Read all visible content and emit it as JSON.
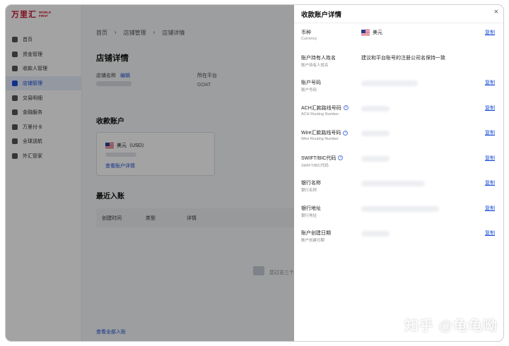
{
  "logo": {
    "cn": "万里汇",
    "en": "WORLD FIRST"
  },
  "sidebar": {
    "items": [
      {
        "label": "首页",
        "icon": "home-icon"
      },
      {
        "label": "资金管理",
        "icon": "funds-icon"
      },
      {
        "label": "收款人管理",
        "icon": "payee-icon"
      },
      {
        "label": "店铺管理",
        "icon": "store-icon",
        "active": true
      },
      {
        "label": "交易明细",
        "icon": "transactions-icon"
      },
      {
        "label": "金融服务",
        "icon": "finance-icon"
      },
      {
        "label": "万里付卡",
        "icon": "card-icon"
      },
      {
        "label": "全球送航",
        "icon": "global-icon"
      },
      {
        "label": "外汇管家",
        "icon": "fx-icon"
      }
    ]
  },
  "main": {
    "breadcrumb": [
      "首页",
      "›",
      "店铺管理",
      "›",
      "店铺详情"
    ],
    "title": "店铺详情",
    "store_name_label": "店铺名称",
    "edit_label": "编辑",
    "platform_label": "所在平台",
    "platform_value": "GOAT",
    "accounts_title": "收款账户",
    "account_currency": "美元（USD）",
    "account_link": "查看账户详情",
    "recent_title": "最近入账",
    "table_headers": [
      "创建时间",
      "类型",
      "详情"
    ],
    "empty_text": "您过去三个",
    "all_link": "查看全部入账"
  },
  "drawer": {
    "title": "收款账户详情",
    "close": "×",
    "copy_label": "复制",
    "rows": [
      {
        "label": "币种",
        "sub": "Currency",
        "value": "美元",
        "flag": true,
        "copy": true
      },
      {
        "label": "账户持有人姓名",
        "sub": "账户持有人姓名",
        "value": "建议和平台账号的注册公司名保持一致",
        "copy": false
      },
      {
        "label": "账户号码",
        "sub": "账户号码",
        "copy": true
      },
      {
        "label": "ACH汇款路线号码",
        "sub": "ACH Routing Number",
        "info": true,
        "copy": true
      },
      {
        "label": "Wire汇款路线号码",
        "sub": "Wire Routing Number",
        "info": true,
        "copy": true
      },
      {
        "label": "SWIFT/BIC代码",
        "sub": "SWIFT/BIC代码",
        "info": true,
        "copy": true
      },
      {
        "label": "银行名称",
        "sub": "银行名称",
        "copy": true
      },
      {
        "label": "银行地址",
        "sub": "银行地址",
        "copy": true
      },
      {
        "label": "账户创建日期",
        "sub": "账户创建日期",
        "copy": true
      }
    ]
  },
  "watermark": "知乎 @龟龟呦",
  "colors": {
    "brand": "#c8102e",
    "link": "#1d4fd8",
    "active_bg": "#e8eefc"
  }
}
